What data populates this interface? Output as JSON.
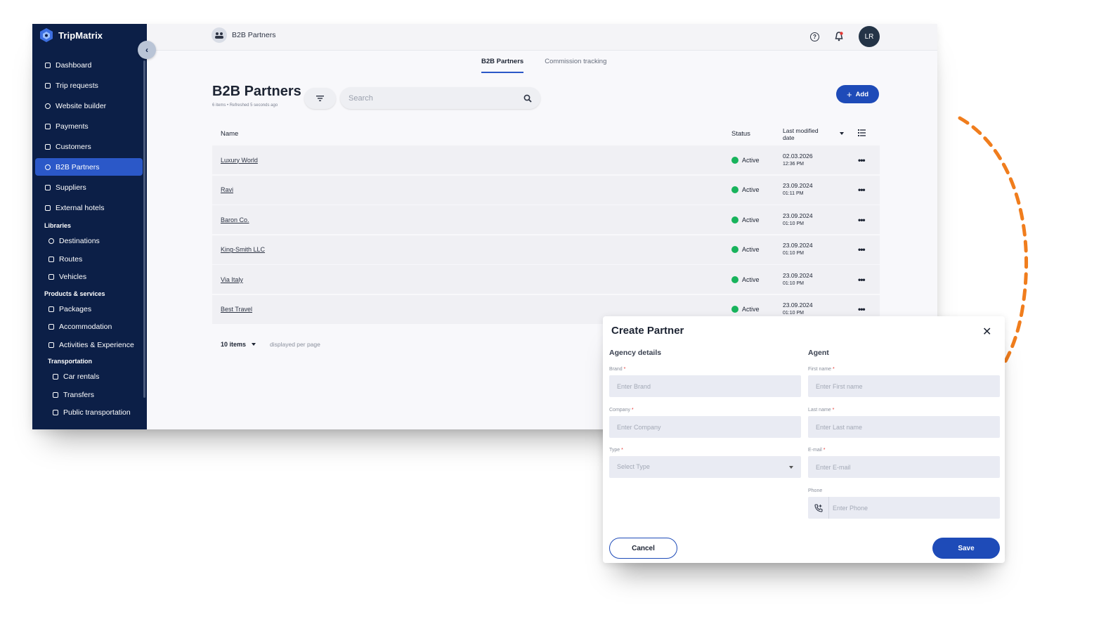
{
  "app": {
    "brand": "TripMatrix"
  },
  "sidebar": {
    "items": [
      {
        "label": "Dashboard",
        "icon": "dashboard-icon"
      },
      {
        "label": "Trip requests",
        "icon": "trip-requests-icon"
      },
      {
        "label": "Website builder",
        "icon": "website-builder-icon"
      },
      {
        "label": "Payments",
        "icon": "payments-icon"
      },
      {
        "label": "Customers",
        "icon": "customers-icon"
      },
      {
        "label": "B2B Partners",
        "icon": "b2b-partners-icon",
        "active": true
      },
      {
        "label": "Suppliers",
        "icon": "suppliers-icon"
      },
      {
        "label": "External hotels",
        "icon": "external-hotels-icon"
      }
    ],
    "libraries_label": "Libraries",
    "libraries": [
      {
        "label": "Destinations",
        "icon": "destinations-icon"
      },
      {
        "label": "Routes",
        "icon": "routes-icon"
      },
      {
        "label": "Vehicles",
        "icon": "vehicles-icon"
      }
    ],
    "products_label": "Products & services",
    "products": [
      {
        "label": "Packages",
        "icon": "packages-icon"
      },
      {
        "label": "Accommodation",
        "icon": "accommodation-icon"
      },
      {
        "label": "Activities & Experience",
        "icon": "activities-icon"
      }
    ],
    "transportation_label": "Transportation",
    "transportation": [
      {
        "label": "Car rentals",
        "icon": "car-rentals-icon"
      },
      {
        "label": "Transfers",
        "icon": "transfers-icon"
      },
      {
        "label": "Public transportation",
        "icon": "public-transportation-icon"
      }
    ]
  },
  "topbar": {
    "breadcrumb": "B2B Partners",
    "avatar": "LR"
  },
  "tabs": [
    "B2B Partners",
    "Commission tracking"
  ],
  "page": {
    "title": "B2B Partners",
    "subtitle": "6 items  •  Refreshed 5 seconds ago",
    "search_placeholder": "Search",
    "add_label": "Add"
  },
  "table": {
    "headers": {
      "name": "Name",
      "status": "Status",
      "modified": "Last modified date"
    },
    "rows": [
      {
        "name": "Luxury World",
        "status": "Active",
        "date": "02.03.2026",
        "time": "12:36 PM"
      },
      {
        "name": "Ravi",
        "status": "Active",
        "date": "23.09.2024",
        "time": "01:11 PM"
      },
      {
        "name": "Baron Co.",
        "status": "Active",
        "date": "23.09.2024",
        "time": "01:10 PM"
      },
      {
        "name": "King-Smith LLC",
        "status": "Active",
        "date": "23.09.2024",
        "time": "01:10 PM"
      },
      {
        "name": "Via Italy",
        "status": "Active",
        "date": "23.09.2024",
        "time": "01:10 PM"
      },
      {
        "name": "Best Travel",
        "status": "Active",
        "date": "23.09.2024",
        "time": "01:10 PM"
      }
    ],
    "more": "•••",
    "status_color": "#18b35c"
  },
  "pager": {
    "count": "10 items",
    "label": "displayed per page"
  },
  "modal": {
    "title": "Create Partner",
    "agency_section": "Agency details",
    "agent_section": "Agent",
    "fields": {
      "brand_label": "Brand",
      "brand_placeholder": "Enter Brand",
      "company_label": "Company",
      "company_placeholder": "Enter Company",
      "type_label": "Type",
      "type_placeholder": "Select Type",
      "first_label": "First name",
      "first_placeholder": "Enter First name",
      "last_label": "Last name",
      "last_placeholder": "Enter Last name",
      "email_label": "E-mail",
      "email_placeholder": "Enter E-mail",
      "phone_label": "Phone",
      "phone_placeholder": "Enter Phone"
    },
    "required_mark": "*",
    "cancel": "Cancel",
    "save": "Save"
  },
  "colors": {
    "sidebar": "#0c1f47",
    "accent": "#1e4bb8",
    "arrow": "#f07d1d"
  }
}
